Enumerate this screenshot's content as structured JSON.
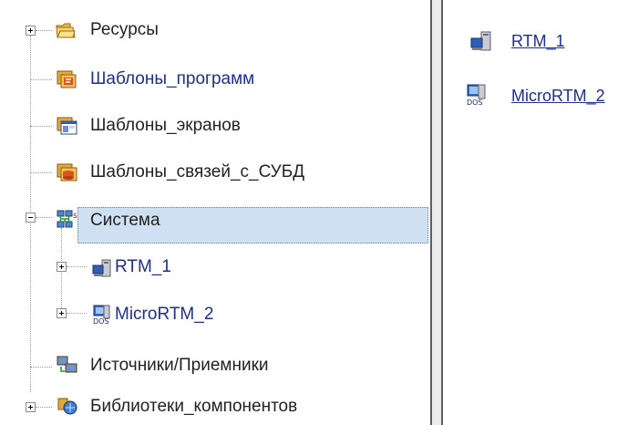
{
  "tree": {
    "items": [
      {
        "label": "Ресурсы",
        "icon": "folder-icon"
      },
      {
        "label": "Шаблоны_программ",
        "icon": "program-templates-icon"
      },
      {
        "label": "Шаблоны_экранов",
        "icon": "screen-templates-icon"
      },
      {
        "label": "Шаблоны_связей_с_СУБД",
        "icon": "dbms-templates-icon"
      },
      {
        "label": "Система",
        "icon": "system-network-icon",
        "selected": true
      },
      {
        "label": "RTM_1",
        "icon": "rtm-computer-icon"
      },
      {
        "label": "MicroRTM_2",
        "icon": "dos-computer-icon"
      },
      {
        "label": "Источники/Приемники",
        "icon": "sources-receivers-icon"
      },
      {
        "label": "Библиотеки_компонентов",
        "icon": "component-library-icon"
      }
    ]
  },
  "right_panel": {
    "items": [
      {
        "label": "RTM_1",
        "icon": "rtm-computer-icon"
      },
      {
        "label": "MicroRTM_2",
        "icon": "dos-computer-icon"
      }
    ]
  },
  "colors": {
    "selection": "#cfe0f2",
    "link": "#1f2f8c"
  }
}
